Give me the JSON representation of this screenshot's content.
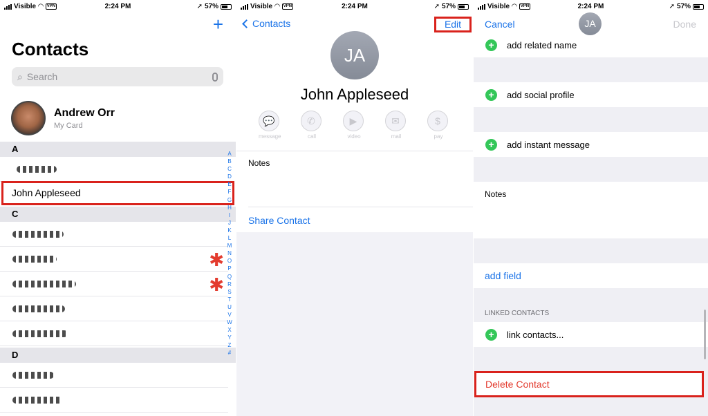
{
  "status": {
    "carrier": "Visible",
    "vpn": "VPN",
    "time": "2:24 PM",
    "battery": "57%"
  },
  "list": {
    "add_icon": "plus-icon",
    "title": "Contacts",
    "search_placeholder": "Search",
    "my_card": {
      "name": "Andrew Orr",
      "subtitle": "My Card"
    },
    "sections": [
      "A",
      "C",
      "D"
    ],
    "highlighted_contact": "John Appleseed",
    "index": [
      "A",
      "B",
      "C",
      "D",
      "E",
      "F",
      "G",
      "H",
      "I",
      "J",
      "K",
      "L",
      "M",
      "N",
      "O",
      "P",
      "Q",
      "R",
      "S",
      "T",
      "U",
      "V",
      "W",
      "X",
      "Y",
      "Z",
      "#"
    ]
  },
  "detail": {
    "back_label": "Contacts",
    "edit_label": "Edit",
    "initials": "JA",
    "name": "John Appleseed",
    "actions": [
      {
        "label": "message",
        "icon": "message-icon"
      },
      {
        "label": "call",
        "icon": "phone-icon"
      },
      {
        "label": "video",
        "icon": "video-icon"
      },
      {
        "label": "mail",
        "icon": "mail-icon"
      },
      {
        "label": "pay",
        "icon": "dollar-icon"
      }
    ],
    "notes_label": "Notes",
    "share_label": "Share Contact"
  },
  "edit": {
    "cancel": "Cancel",
    "initials": "JA",
    "done": "Done",
    "rows": [
      "add related name",
      "add social profile",
      "add instant message"
    ],
    "notes_label": "Notes",
    "add_field": "add field",
    "linked_header": "LINKED CONTACTS",
    "link_contacts": "link contacts...",
    "delete": "Delete Contact"
  },
  "colors": {
    "accent": "#1a73e8",
    "highlight": "#d9221c",
    "destructive": "#e33b2e",
    "add_green": "#34c759"
  }
}
